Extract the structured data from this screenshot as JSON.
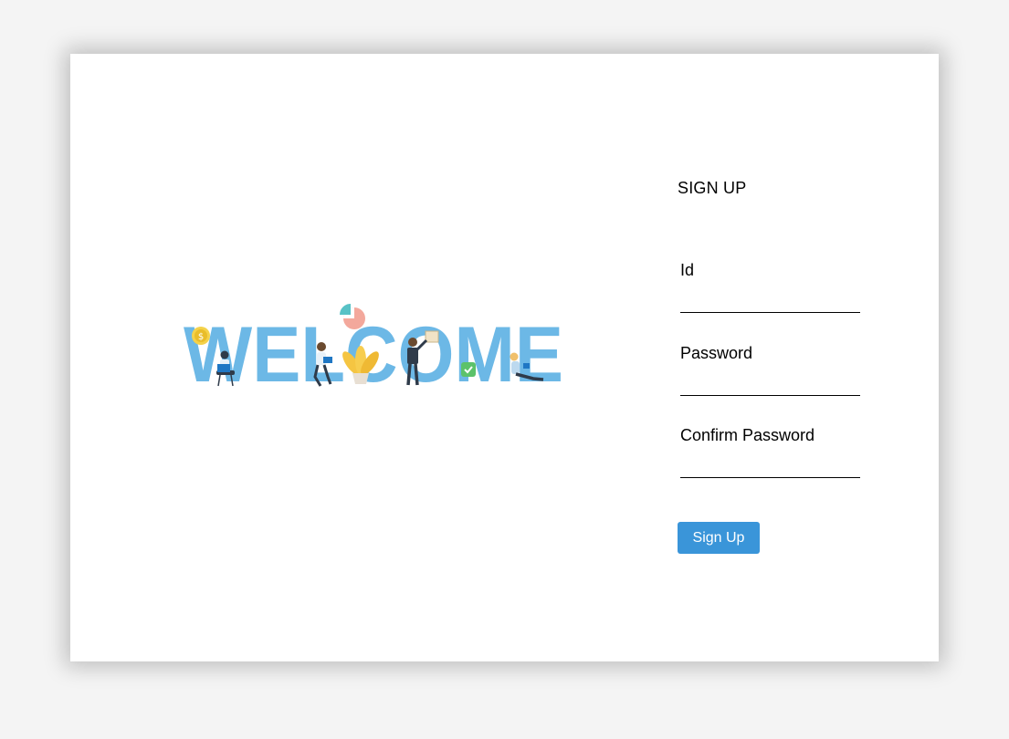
{
  "illustration": {
    "word": "WELCOME",
    "color": "#6cb8e6"
  },
  "form": {
    "title": "SIGN UP",
    "fields": [
      {
        "label": "Id",
        "value": "",
        "placeholder": ""
      },
      {
        "label": "Password",
        "value": "",
        "placeholder": ""
      },
      {
        "label": "Confirm Password",
        "value": "",
        "placeholder": ""
      }
    ],
    "submit_label": "Sign Up"
  },
  "colors": {
    "accent": "#3a95d9",
    "letters": "#6cb8e6"
  }
}
